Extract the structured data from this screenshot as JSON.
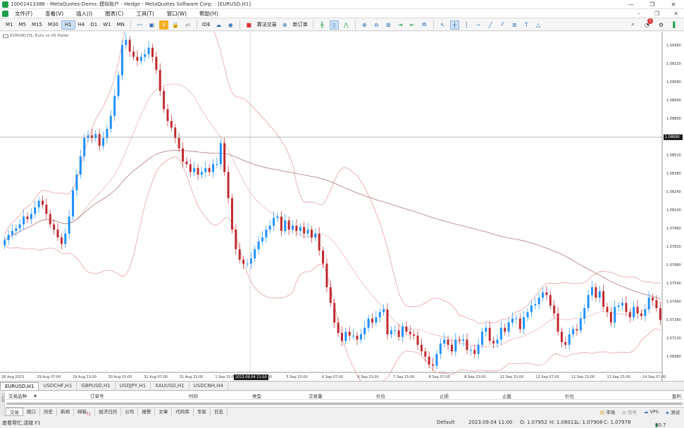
{
  "window": {
    "title": "10001413386 - MetaQuotes-Demo: 模拟账户 - Hedge - MetaQuotes Software Corp. - [EURUSD,H1]"
  },
  "menu": {
    "items": [
      "文件(F)",
      "查看(V)",
      "插入(I)",
      "图表(C)",
      "工具(T)",
      "窗口(W)",
      "帮助(H)"
    ]
  },
  "toolbar": {
    "timeframes": [
      "M1",
      "M5",
      "M15",
      "M30",
      "H1",
      "H4",
      "D1",
      "W1",
      "MN"
    ],
    "active_timeframe": "H1",
    "ide_label": "IDE",
    "algo_label": "算法交易",
    "new_order_label": "新订单",
    "notification_count": "1"
  },
  "chart": {
    "label": "EURUSD,H1:  Euro vs US Dollar",
    "price_labels": [
      "1.09360",
      "1.09220",
      "1.09080",
      "1.08940",
      "1.08800",
      "1.08666",
      "1.08520",
      "1.08380",
      "1.08240",
      "1.08100",
      "1.07960",
      "1.07820",
      "1.07680",
      "1.07540",
      "1.07400",
      "1.07260",
      "1.07120",
      "1.06980"
    ],
    "current_price": "1.08666",
    "time_labels": [
      "28 Aug 2023",
      "29 Aug 07:00",
      "29 Aug 23:00",
      "30 Aug 15:00",
      "31 Aug 07:00",
      "31 Aug 23:00",
      "1 Sep 15:00",
      "4 Sep 23:00",
      "5 Sep 15:00",
      "6 Sep 07:00",
      "6 Sep 23:00",
      "7 Sep 15:00",
      "8 Sep 07:00",
      "8 Sep 23:00",
      "11 Sep 15:00",
      "12 Sep 07:00",
      "12 Sep 23:00",
      "13 Sep 15:00",
      "14 Sep 07:00"
    ],
    "cursor_time": "2023.09.04 11:00"
  },
  "chart_data": {
    "type": "candlestick",
    "symbol": "EURUSD,H1",
    "ylim": [
      1.0688,
      1.0944
    ],
    "close": [
      1.0788,
      1.0792,
      1.0795,
      1.0797,
      1.08,
      1.0806,
      1.0804,
      1.0808,
      1.0813,
      1.0818,
      1.0815,
      1.0808,
      1.08,
      1.0796,
      1.079,
      1.0785,
      1.0793,
      1.0806,
      1.0826,
      1.0838,
      1.0852,
      1.0866,
      1.0868,
      1.0866,
      1.0869,
      1.086,
      1.0866,
      1.0873,
      1.0883,
      1.0898,
      1.0914,
      1.0937,
      1.0941,
      1.0932,
      1.0928,
      1.0925,
      1.0928,
      1.093,
      1.0935,
      1.0928,
      1.0918,
      1.0902,
      1.0888,
      1.0879,
      1.0874,
      1.0866,
      1.0858,
      1.0848,
      1.0846,
      1.084,
      1.0843,
      1.0838,
      1.084,
      1.0843,
      1.084,
      1.0846,
      1.0846,
      1.0862,
      1.084,
      1.082,
      1.0796,
      1.0781,
      1.0773,
      1.077,
      1.077,
      1.0774,
      1.0781,
      1.0787,
      1.079,
      1.0796,
      1.0799,
      1.0805,
      1.0806,
      1.0795,
      1.0803,
      1.0796,
      1.0799,
      1.0795,
      1.0798,
      1.0793,
      1.0796,
      1.079,
      1.0793,
      1.078,
      1.077,
      1.0752,
      1.074,
      1.0725,
      1.0717,
      1.0711,
      1.0718,
      1.0715,
      1.0715,
      1.0712,
      1.0716,
      1.0721,
      1.0728,
      1.0725,
      1.0729,
      1.0733,
      1.0735,
      1.0716,
      1.0719,
      1.0719,
      1.0714,
      1.0722,
      1.0718,
      1.0716,
      1.0715,
      1.0708,
      1.0703,
      1.0699,
      1.0693,
      1.0692,
      1.0701,
      1.0709,
      1.0712,
      1.0708,
      1.0703,
      1.0712,
      1.0711,
      1.0712,
      1.0704,
      1.0704,
      1.0701,
      1.0708,
      1.0718,
      1.0721,
      1.0711,
      1.0709,
      1.0712,
      1.0721,
      1.0718,
      1.0725,
      1.0728,
      1.0728,
      1.072,
      1.0729,
      1.0733,
      1.0738,
      1.0739,
      1.0744,
      1.0748,
      1.0746,
      1.0738,
      1.0732,
      1.0718,
      1.071,
      1.0708,
      1.0716,
      1.072,
      1.0719,
      1.0728,
      1.0736,
      1.0746,
      1.0752,
      1.0744,
      1.0749,
      1.0737,
      1.0733,
      1.0725,
      1.0737,
      1.0738,
      1.074,
      1.0733,
      1.0729,
      1.0737,
      1.0732,
      1.073,
      1.0735,
      1.0744,
      1.0742,
      1.0736,
      1.0727
    ],
    "series": [
      {
        "name": "MA 200"
      },
      {
        "name": "Bollinger Bands 20"
      }
    ]
  },
  "symbol_tabs": [
    "EURUSD,H1",
    "USDCHF,H1",
    "GBPUSD,H1",
    "USDJPY,H1",
    "XAUUSD,H1",
    "USDCNH,H4"
  ],
  "toolbox": {
    "side_label": "工具箱",
    "columns": [
      "交易品种",
      "订单号",
      "时间",
      "类型",
      "交易量",
      "价位",
      "止损",
      "止盈",
      "价位",
      "盈利"
    ],
    "tabs": [
      "交易",
      "敞口",
      "历史",
      "新闻",
      "邮箱",
      "经济日历",
      "公司",
      "报警",
      "文章",
      "代码库",
      "专家",
      "日志"
    ],
    "mail_count": "11",
    "right_items": [
      "市场",
      "信号",
      "VPS",
      "测试"
    ]
  },
  "status": {
    "help": "查看帮忙,请按 F1",
    "profile": "Default",
    "datetime": "2023.09.04 11:00",
    "open": "O: 1.07952",
    "high": "H: 1.08011",
    "low": "L: 1.07908",
    "close": "C: 1.07978",
    "connection": "80.7"
  },
  "colors": {
    "bull": "#1e90ff",
    "bear": "#c0282d",
    "bands": "#e8a0a0",
    "ma": "#b07a7a"
  }
}
